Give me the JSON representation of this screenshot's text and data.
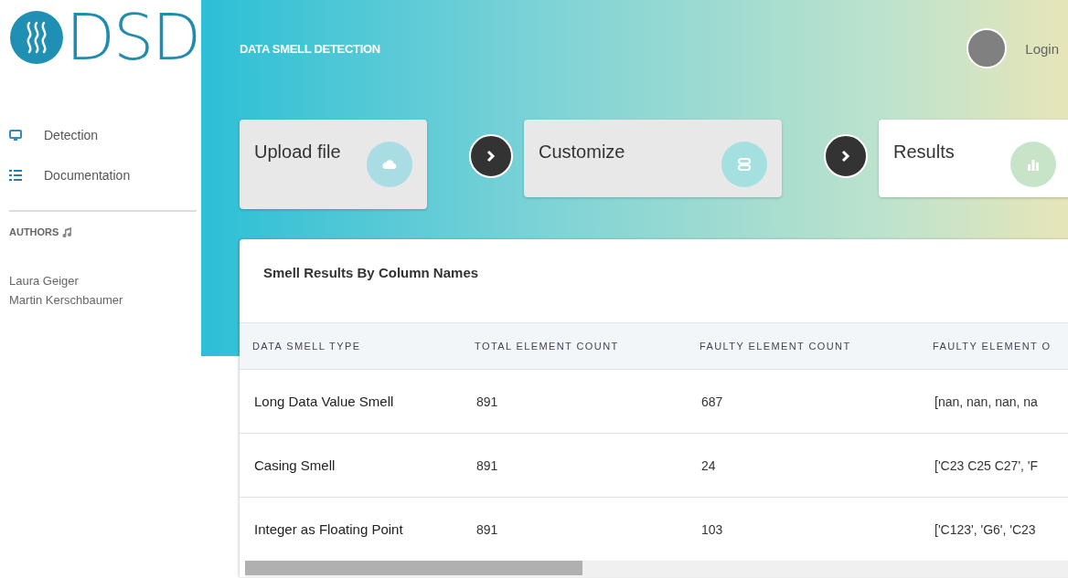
{
  "logo": {
    "text": "DSD"
  },
  "sidebar": {
    "items": [
      {
        "label": "Detection"
      },
      {
        "label": "Documentation"
      }
    ],
    "authors_heading": "AUTHORS",
    "authors": [
      "Laura Geiger",
      "Martin Kerschbaumer"
    ]
  },
  "header": {
    "title": "DATA SMELL DETECTION",
    "login": "Login"
  },
  "steps": [
    {
      "label": "Upload file",
      "selected": false
    },
    {
      "label": "Customize",
      "selected": false
    },
    {
      "label": "Results",
      "selected": true
    }
  ],
  "results": {
    "title": "Smell Results By Column Names",
    "columns": [
      "DATA SMELL TYPE",
      "TOTAL ELEMENT COUNT",
      "FAULTY ELEMENT COUNT",
      "FAULTY ELEMENT O"
    ],
    "rows": [
      [
        "Long Data Value Smell",
        "891",
        "687",
        "[nan, nan, nan, na"
      ],
      [
        "Casing Smell",
        "891",
        "24",
        "['C23 C25 C27', 'F"
      ],
      [
        "Integer as Floating Point",
        "891",
        "103",
        "['C123', 'G6', 'C23"
      ]
    ]
  }
}
